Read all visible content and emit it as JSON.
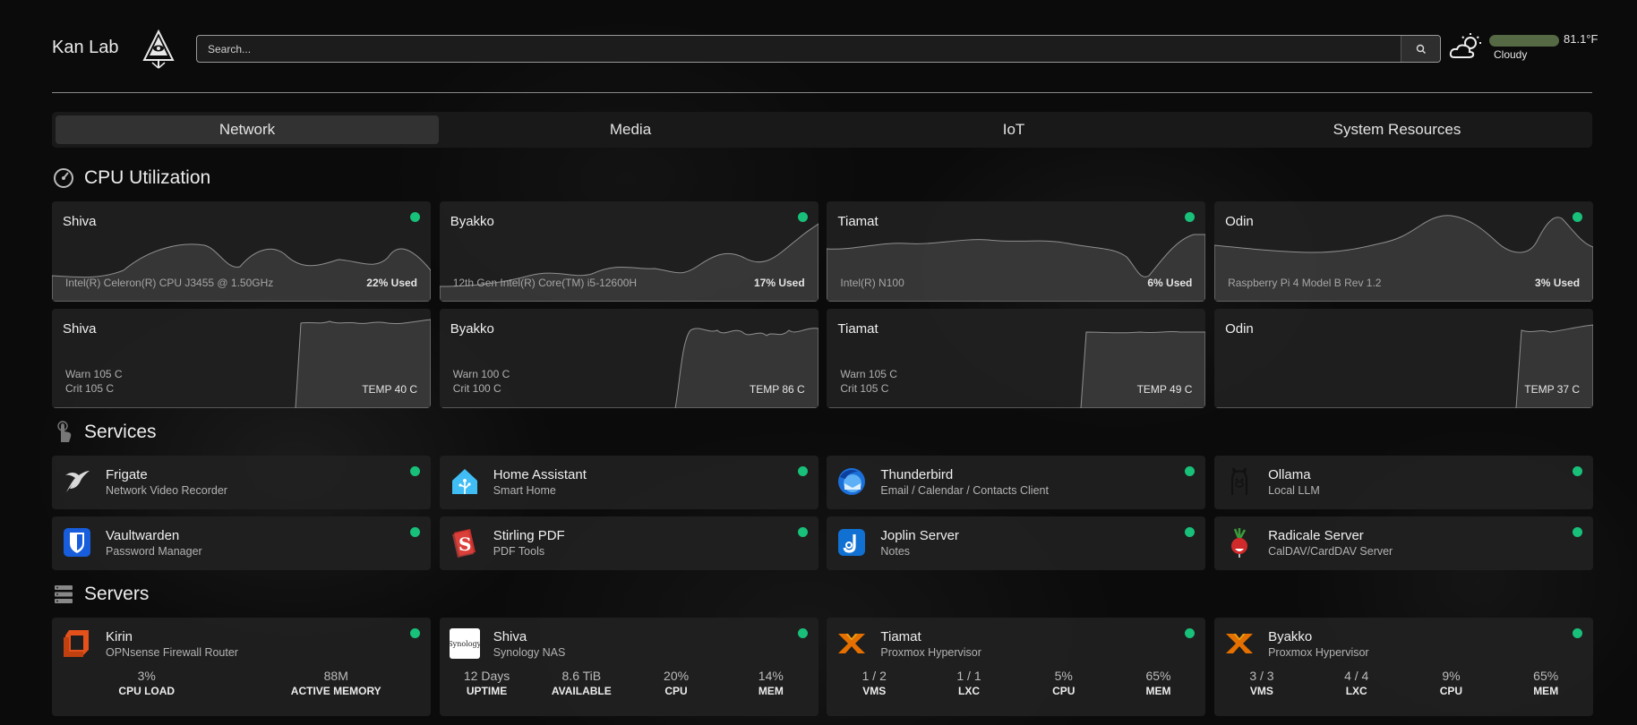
{
  "header": {
    "brand": "Kan Lab",
    "search_placeholder": "Search...",
    "weather": {
      "temp": "81.1°F",
      "condition": "Cloudy"
    }
  },
  "tabs": [
    {
      "label": "Network",
      "active": true
    },
    {
      "label": "Media",
      "active": false
    },
    {
      "label": "IoT",
      "active": false
    },
    {
      "label": "System Resources",
      "active": false
    }
  ],
  "cpu_section": {
    "title": "CPU Utilization",
    "cpu_cards": [
      {
        "name": "Shiva",
        "cpu": "Intel(R) Celeron(R) CPU J3455 @ 1.50GHz",
        "used": "22% Used",
        "status": "online"
      },
      {
        "name": "Byakko",
        "cpu": "12th Gen Intel(R) Core(TM) i5-12600H",
        "used": "17% Used",
        "status": "online"
      },
      {
        "name": "Tiamat",
        "cpu": "Intel(R) N100",
        "used": "6% Used",
        "status": "online"
      },
      {
        "name": "Odin",
        "cpu": "Raspberry Pi 4 Model B Rev 1.2",
        "used": "3% Used",
        "status": "online"
      }
    ],
    "temp_cards": [
      {
        "name": "Shiva",
        "warn": "Warn 105 C",
        "crit": "Crit 105 C",
        "temp": "TEMP 40 C"
      },
      {
        "name": "Byakko",
        "warn": "Warn 100 C",
        "crit": "Crit 100 C",
        "temp": "TEMP 86 C"
      },
      {
        "name": "Tiamat",
        "warn": "Warn 105 C",
        "crit": "Crit 105 C",
        "temp": "TEMP 49 C"
      },
      {
        "name": "Odin",
        "warn": "",
        "crit": "",
        "temp": "TEMP 37 C"
      }
    ]
  },
  "services_section": {
    "title": "Services",
    "items": [
      {
        "name": "Frigate",
        "desc": "Network Video Recorder",
        "icon": "frigate-bird-icon",
        "status": "online"
      },
      {
        "name": "Home Assistant",
        "desc": "Smart Home",
        "icon": "home-assistant-icon",
        "status": "online"
      },
      {
        "name": "Thunderbird",
        "desc": "Email / Calendar / Contacts Client",
        "icon": "thunderbird-icon",
        "status": "online"
      },
      {
        "name": "Ollama",
        "desc": "Local LLM",
        "icon": "ollama-llama-icon",
        "status": "online"
      },
      {
        "name": "Vaultwarden",
        "desc": "Password Manager",
        "icon": "vaultwarden-shield-icon",
        "status": "online"
      },
      {
        "name": "Stirling PDF",
        "desc": "PDF Tools",
        "icon": "stirling-pdf-icon",
        "status": "online"
      },
      {
        "name": "Joplin Server",
        "desc": "Notes",
        "icon": "joplin-icon",
        "status": "online"
      },
      {
        "name": "Radicale Server",
        "desc": "CalDAV/CardDAV Server",
        "icon": "radicale-radish-icon",
        "status": "online"
      }
    ]
  },
  "servers_section": {
    "title": "Servers",
    "items": [
      {
        "name": "Kirin",
        "desc": "OPNsense Firewall Router",
        "icon": "opnsense-icon",
        "stats": [
          {
            "value": "3%",
            "label": "CPU LOAD"
          },
          {
            "value": "88M",
            "label": "ACTIVE MEMORY"
          }
        ]
      },
      {
        "name": "Shiva",
        "desc": "Synology NAS",
        "icon": "synology-icon",
        "logo_text": "Synology",
        "stats": [
          {
            "value": "12 Days",
            "label": "UPTIME"
          },
          {
            "value": "8.6 TiB",
            "label": "AVAILABLE"
          },
          {
            "value": "20%",
            "label": "CPU"
          },
          {
            "value": "14%",
            "label": "MEM"
          }
        ]
      },
      {
        "name": "Tiamat",
        "desc": "Proxmox Hypervisor",
        "icon": "proxmox-icon",
        "stats": [
          {
            "value": "1 / 2",
            "label": "VMS"
          },
          {
            "value": "1 / 1",
            "label": "LXC"
          },
          {
            "value": "5%",
            "label": "CPU"
          },
          {
            "value": "65%",
            "label": "MEM"
          }
        ]
      },
      {
        "name": "Byakko",
        "desc": "Proxmox Hypervisor",
        "icon": "proxmox-icon",
        "stats": [
          {
            "value": "3 / 3",
            "label": "VMS"
          },
          {
            "value": "4 / 4",
            "label": "LXC"
          },
          {
            "value": "9%",
            "label": "CPU"
          },
          {
            "value": "65%",
            "label": "MEM"
          }
        ]
      }
    ]
  },
  "colors": {
    "status_online": "#18c07a",
    "card_bg": "#212121",
    "accent": "#e6e6e6"
  }
}
